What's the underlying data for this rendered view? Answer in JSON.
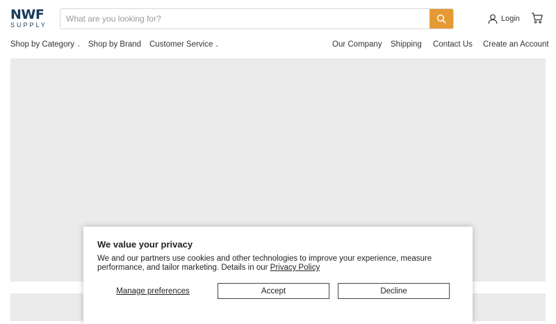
{
  "header": {
    "logo_top": "NWF",
    "logo_bottom": "SUPPLY",
    "search_placeholder": "What are you looking for?",
    "search_icon": "search-icon",
    "login_label": "Login",
    "login_icon": "user-icon",
    "cart_icon": "cart-icon",
    "accent_color": "#e49a34"
  },
  "nav": {
    "left": [
      {
        "label": "Shop by Category",
        "has_dropdown": true
      },
      {
        "label": "Shop by Brand",
        "has_dropdown": false
      },
      {
        "label": "Customer Service",
        "has_dropdown": true
      }
    ],
    "right": [
      {
        "label": "Our Company"
      },
      {
        "label": "Shipping"
      },
      {
        "label": "Contact Us"
      },
      {
        "label": "Create an Account"
      }
    ]
  },
  "cookie": {
    "title": "We value your privacy",
    "body": "We and our partners use cookies and other technologies to improve your experience, measure performance, and tailor marketing. Details in our ",
    "link": "Privacy Policy",
    "manage": "Manage preferences",
    "accept": "Accept",
    "decline": "Decline"
  }
}
